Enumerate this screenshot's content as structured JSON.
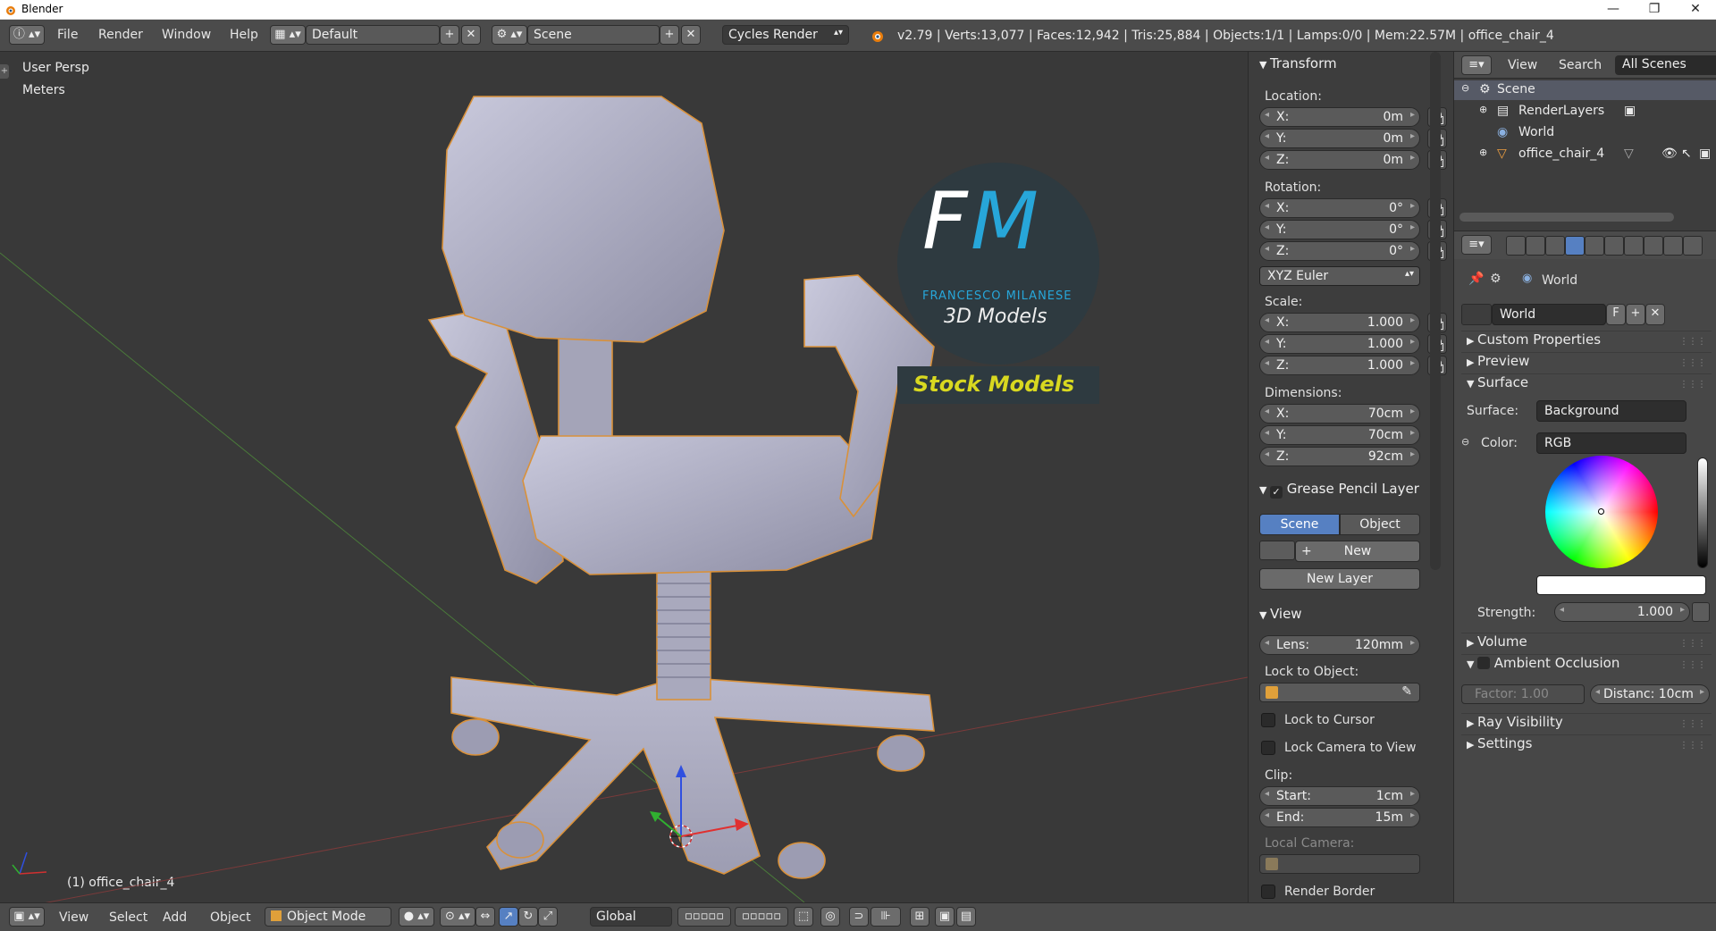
{
  "window": {
    "title": "Blender",
    "controls": [
      "—",
      "❐",
      "✕"
    ]
  },
  "topbar": {
    "menus": [
      "File",
      "Render",
      "Window",
      "Help"
    ],
    "layout": "Default",
    "scene": "Scene",
    "engine": "Cycles Render",
    "stats": "v2.79 | Verts:13,077 | Faces:12,942 | Tris:25,884 | Objects:1/1 | Lamps:0/0 | Mem:22.57M | office_chair_4"
  },
  "viewport": {
    "view_name": "User Persp",
    "units": "Meters",
    "object_label": "(1) office_chair_4",
    "watermark": {
      "monogram_f": "F",
      "monogram_m": "M",
      "name": "FRANCESCO MILANESE",
      "sub": "3D Models",
      "banner": "Stock Models"
    }
  },
  "npanel": {
    "transform": {
      "title": "Transform",
      "location_label": "Location:",
      "location": [
        {
          "k": "X:",
          "v": "0m"
        },
        {
          "k": "Y:",
          "v": "0m"
        },
        {
          "k": "Z:",
          "v": "0m"
        }
      ],
      "rotation_label": "Rotation:",
      "rotation": [
        {
          "k": "X:",
          "v": "0°"
        },
        {
          "k": "Y:",
          "v": "0°"
        },
        {
          "k": "Z:",
          "v": "0°"
        }
      ],
      "rotation_mode": "XYZ Euler",
      "scale_label": "Scale:",
      "scale": [
        {
          "k": "X:",
          "v": "1.000"
        },
        {
          "k": "Y:",
          "v": "1.000"
        },
        {
          "k": "Z:",
          "v": "1.000"
        }
      ],
      "dimensions_label": "Dimensions:",
      "dimensions": [
        {
          "k": "X:",
          "v": "70cm"
        },
        {
          "k": "Y:",
          "v": "70cm"
        },
        {
          "k": "Z:",
          "v": "92cm"
        }
      ]
    },
    "grease": {
      "title": "Grease Pencil Layer",
      "tab_scene": "Scene",
      "tab_object": "Object",
      "new": "New",
      "new_layer": "New Layer"
    },
    "view": {
      "title": "View",
      "lens_k": "Lens:",
      "lens_v": "120mm",
      "lock_obj": "Lock to Object:",
      "lock_cursor": "Lock to Cursor",
      "lock_camera": "Lock Camera to View",
      "clip": "Clip:",
      "start_k": "Start:",
      "start_v": "1cm",
      "end_k": "End:",
      "end_v": "15m",
      "local_camera": "Local Camera:",
      "render_border": "Render Border"
    }
  },
  "outliner": {
    "menus": [
      "View",
      "Search"
    ],
    "filter": "All Scenes",
    "items": [
      "Scene",
      "RenderLayers",
      "World",
      "office_chair_4"
    ]
  },
  "properties": {
    "breadcrumb": "World",
    "world_name": "World",
    "fake_user": "F",
    "sections": {
      "custom": "Custom Properties",
      "preview": "Preview",
      "surface": "Surface",
      "volume": "Volume",
      "ao": "Ambient Occlusion",
      "ray": "Ray Visibility",
      "settings": "Settings"
    },
    "surface_label": "Surface:",
    "surface_value": "Background",
    "color_label": "Color:",
    "color_mode": "RGB",
    "strength_label": "Strength:",
    "strength_value": "1.000",
    "factor": "Factor:  1.00",
    "distance": "Distanc: 10cm"
  },
  "bottombar": {
    "menus": [
      "View",
      "Select",
      "Add",
      "Object"
    ],
    "mode": "Object Mode",
    "orientation": "Global"
  },
  "colors": {
    "viewport_bg": "#393939",
    "panel_bg": "#3d3d3d",
    "accent_blue": "#5680c2",
    "selection_orange": "#f0a040",
    "watermark_yellow": "#d8d820",
    "watermark_cyan": "#27a6d9"
  }
}
